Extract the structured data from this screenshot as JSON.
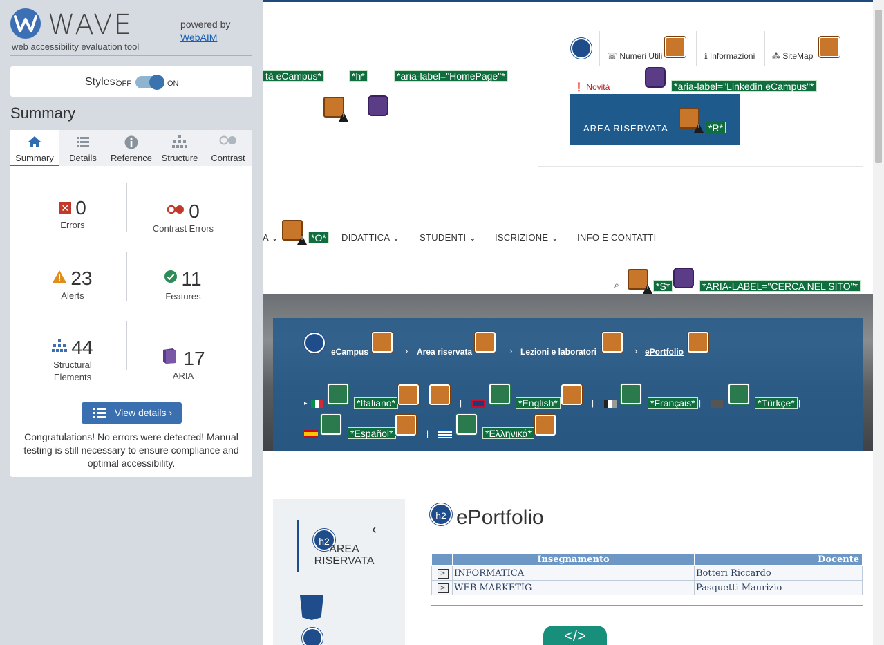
{
  "wave": {
    "logo_word": "WAVE",
    "tagline": "web accessibility evaluation tool",
    "powered_by": "powered by",
    "webaim": "WebAIM",
    "styles_label": "Styles:",
    "off": "OFF",
    "on": "ON",
    "summary_heading": "Summary",
    "tabs": [
      {
        "label": "Summary",
        "icon": "home-icon"
      },
      {
        "label": "Details",
        "icon": "list-icon"
      },
      {
        "label": "Reference",
        "icon": "info-icon"
      },
      {
        "label": "Structure",
        "icon": "structure-icon"
      },
      {
        "label": "Contrast",
        "icon": "contrast-icon"
      }
    ],
    "stats": {
      "errors": {
        "num": "0",
        "label": "Errors"
      },
      "contrast": {
        "num": "0",
        "label": "Contrast Errors"
      },
      "alerts": {
        "num": "23",
        "label": "Alerts"
      },
      "features": {
        "num": "11",
        "label": "Features"
      },
      "structural": {
        "num": "44",
        "label": "Structural Elements"
      },
      "aria": {
        "num": "17",
        "label": "ARIA"
      }
    },
    "view_details": "View details ›",
    "congrats": "Congratulations! No errors were detected! Manual testing is still necessary to ensure compliance and optimal accessibility.",
    "colors": {
      "error": "#c0392b",
      "alert": "#e08e1b",
      "feature": "#2e8b57",
      "aria": "#5b3c86",
      "structure": "#3d6fb5"
    }
  },
  "site": {
    "tags": {
      "ecampus": "tà eCampus*",
      "h": "*h*",
      "homepage": "*aria-label=\"HomePage\"*",
      "linkedin": "*aria-label=\"Linkedin eCampus\"*",
      "r": "*R*",
      "o": "*O*",
      "s": "*S*",
      "cerca": "*ARIA-LABEL=\"CERCA NEL SITO\"*"
    },
    "top_links": {
      "numeri": "Numeri Utili",
      "info": "Informazioni",
      "sitemap": "SiteMap",
      "novita": "Novità"
    },
    "area_riservata": "AREA RISERVATA",
    "nav": [
      "A",
      "DIDATTICA",
      "STUDENTI",
      "ISCRIZIONE",
      "INFO E CONTATTI"
    ],
    "breadcrumb": [
      "eCampus",
      "Area riservata",
      "Lezioni e laboratori",
      "ePortfolio"
    ],
    "languages": [
      {
        "label": "*Italiano*"
      },
      {
        "label": "*English*"
      },
      {
        "label": "*Français*"
      },
      {
        "label": "*Türkçe*"
      },
      {
        "label": "*Español*"
      },
      {
        "label": "*Ελληνικά*"
      }
    ],
    "side_h2": "h2",
    "side_title": "AREA RISERVATA",
    "content_title": "ePortfolio",
    "table": {
      "headers": [
        "",
        "Insegnamento",
        "Docente"
      ],
      "rows": [
        {
          "btn": ">",
          "course": "INFORMATICA",
          "teacher": "Botteri Riccardo"
        },
        {
          "btn": ">",
          "course": "WEB MARKETIG",
          "teacher": "Pasquetti Maurizio"
        }
      ]
    },
    "code_icon": "</>"
  }
}
